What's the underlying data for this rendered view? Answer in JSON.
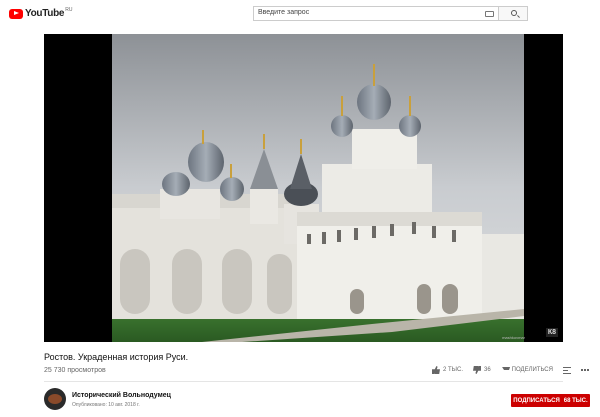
{
  "header": {
    "logo_text": "YouTube",
    "logo_country": "RU",
    "search_placeholder": "Введите запрос"
  },
  "video": {
    "title": "Ростов. Украденная история Руси.",
    "views": "25 730 просмотров",
    "watermark": "К8",
    "credit": "mashkovmar"
  },
  "actions": {
    "likes": "2 ТЫС.",
    "dislikes": "36",
    "share_label": "ПОДЕЛИТЬСЯ"
  },
  "channel": {
    "name": "Исторический Вольнодумец",
    "published": "Опубликовано: 10 авг. 2018 г."
  },
  "subscribe": {
    "label": "ПОДПИСАТЬСЯ",
    "count": "68 ТЫС."
  },
  "colors": {
    "brand_red": "#ff0000",
    "subscribe_bg": "#cc0000"
  },
  "icons": [
    "youtube-logo-icon",
    "keyboard-icon",
    "search-icon",
    "like-icon",
    "dislike-icon",
    "share-icon",
    "add-to-playlist-icon",
    "more-icon"
  ]
}
